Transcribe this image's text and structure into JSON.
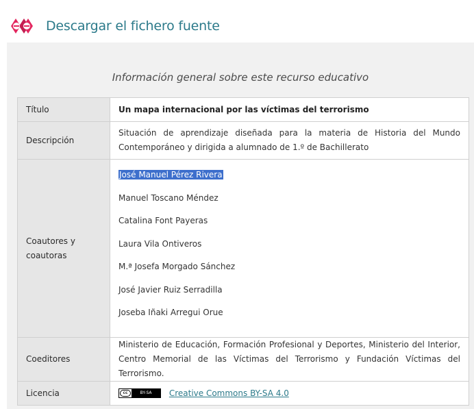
{
  "header": {
    "download_label": "Descargar el fichero fuente"
  },
  "caption": "Información general sobre este recurso educativo",
  "table": {
    "title": {
      "label": "Título",
      "value": "Un mapa internacional por las víctimas del terrorismo"
    },
    "description": {
      "label": "Descripción",
      "value": "Situación de aprendizaje diseñada para la materia de Historia del Mundo Contemporáneo y dirigida a alumnado de 1.º de Bachillerato"
    },
    "authors": {
      "label_line1": "Coautores y",
      "label_line2": "coautoras",
      "items": [
        "José Manuel Pérez Rivera",
        "Manuel Toscano Méndez",
        "Catalina Font Payeras",
        "Laura Vila Ontiveros",
        "M.ª Josefa Morgado Sánchez",
        "José Javier Ruiz Serradilla",
        "Joseba Iñaki Arregui Orue"
      ]
    },
    "editors": {
      "label": "Coeditores",
      "value": "Ministerio de Educación, Formación Profesional y Deportes, Ministerio del Interior, Centro Memorial de las Víctimas del Terrorismo y Fundación Víctimas del Terrorismo."
    },
    "license": {
      "label": "Licencia",
      "badge_cc": "cc",
      "badge_terms": "BY-SA",
      "link_text": "Creative Commons BY-SA 4.0"
    }
  },
  "colors": {
    "accent": "#2c7a8a",
    "logo": "#e3275f",
    "selection": "#3d6fcc",
    "panel_bg": "#f1f1f1",
    "label_bg": "#e6e6e6"
  },
  "icons": {
    "logo": "exe-logo-icon"
  }
}
